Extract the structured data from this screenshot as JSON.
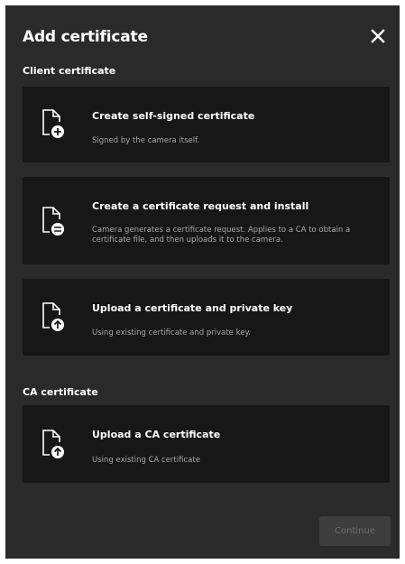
{
  "dialog": {
    "title": "Add certificate",
    "close_icon": "close-icon"
  },
  "sections": {
    "client": {
      "label": "Client certificate",
      "cards": [
        {
          "title": "Create self-signed certificate",
          "description": "Signed by the camera itself.",
          "icon": "document-plus-icon"
        },
        {
          "title": "Create a certificate request and install",
          "description": "Camera generates a certificate request. Applies to a CA to obtain a certificate file, and then uploads it to the camera.",
          "icon": "document-request-icon"
        },
        {
          "title": "Upload a certificate and private key",
          "description": "Using existing certificate and private key.",
          "icon": "document-upload-icon"
        }
      ]
    },
    "ca": {
      "label": "CA certificate",
      "cards": [
        {
          "title": "Upload a CA certificate",
          "description": "Using existing CA certificate",
          "icon": "document-upload-icon"
        }
      ]
    }
  },
  "footer": {
    "continue_label": "Continue",
    "continue_enabled": false
  },
  "colors": {
    "dialog_background": "#2a2a2a",
    "card_background": "#171717",
    "text_primary": "#ffffff",
    "text_secondary": "#a8a8a8",
    "button_disabled_background": "#3d3d3d",
    "button_disabled_text": "#6f6f6f"
  }
}
